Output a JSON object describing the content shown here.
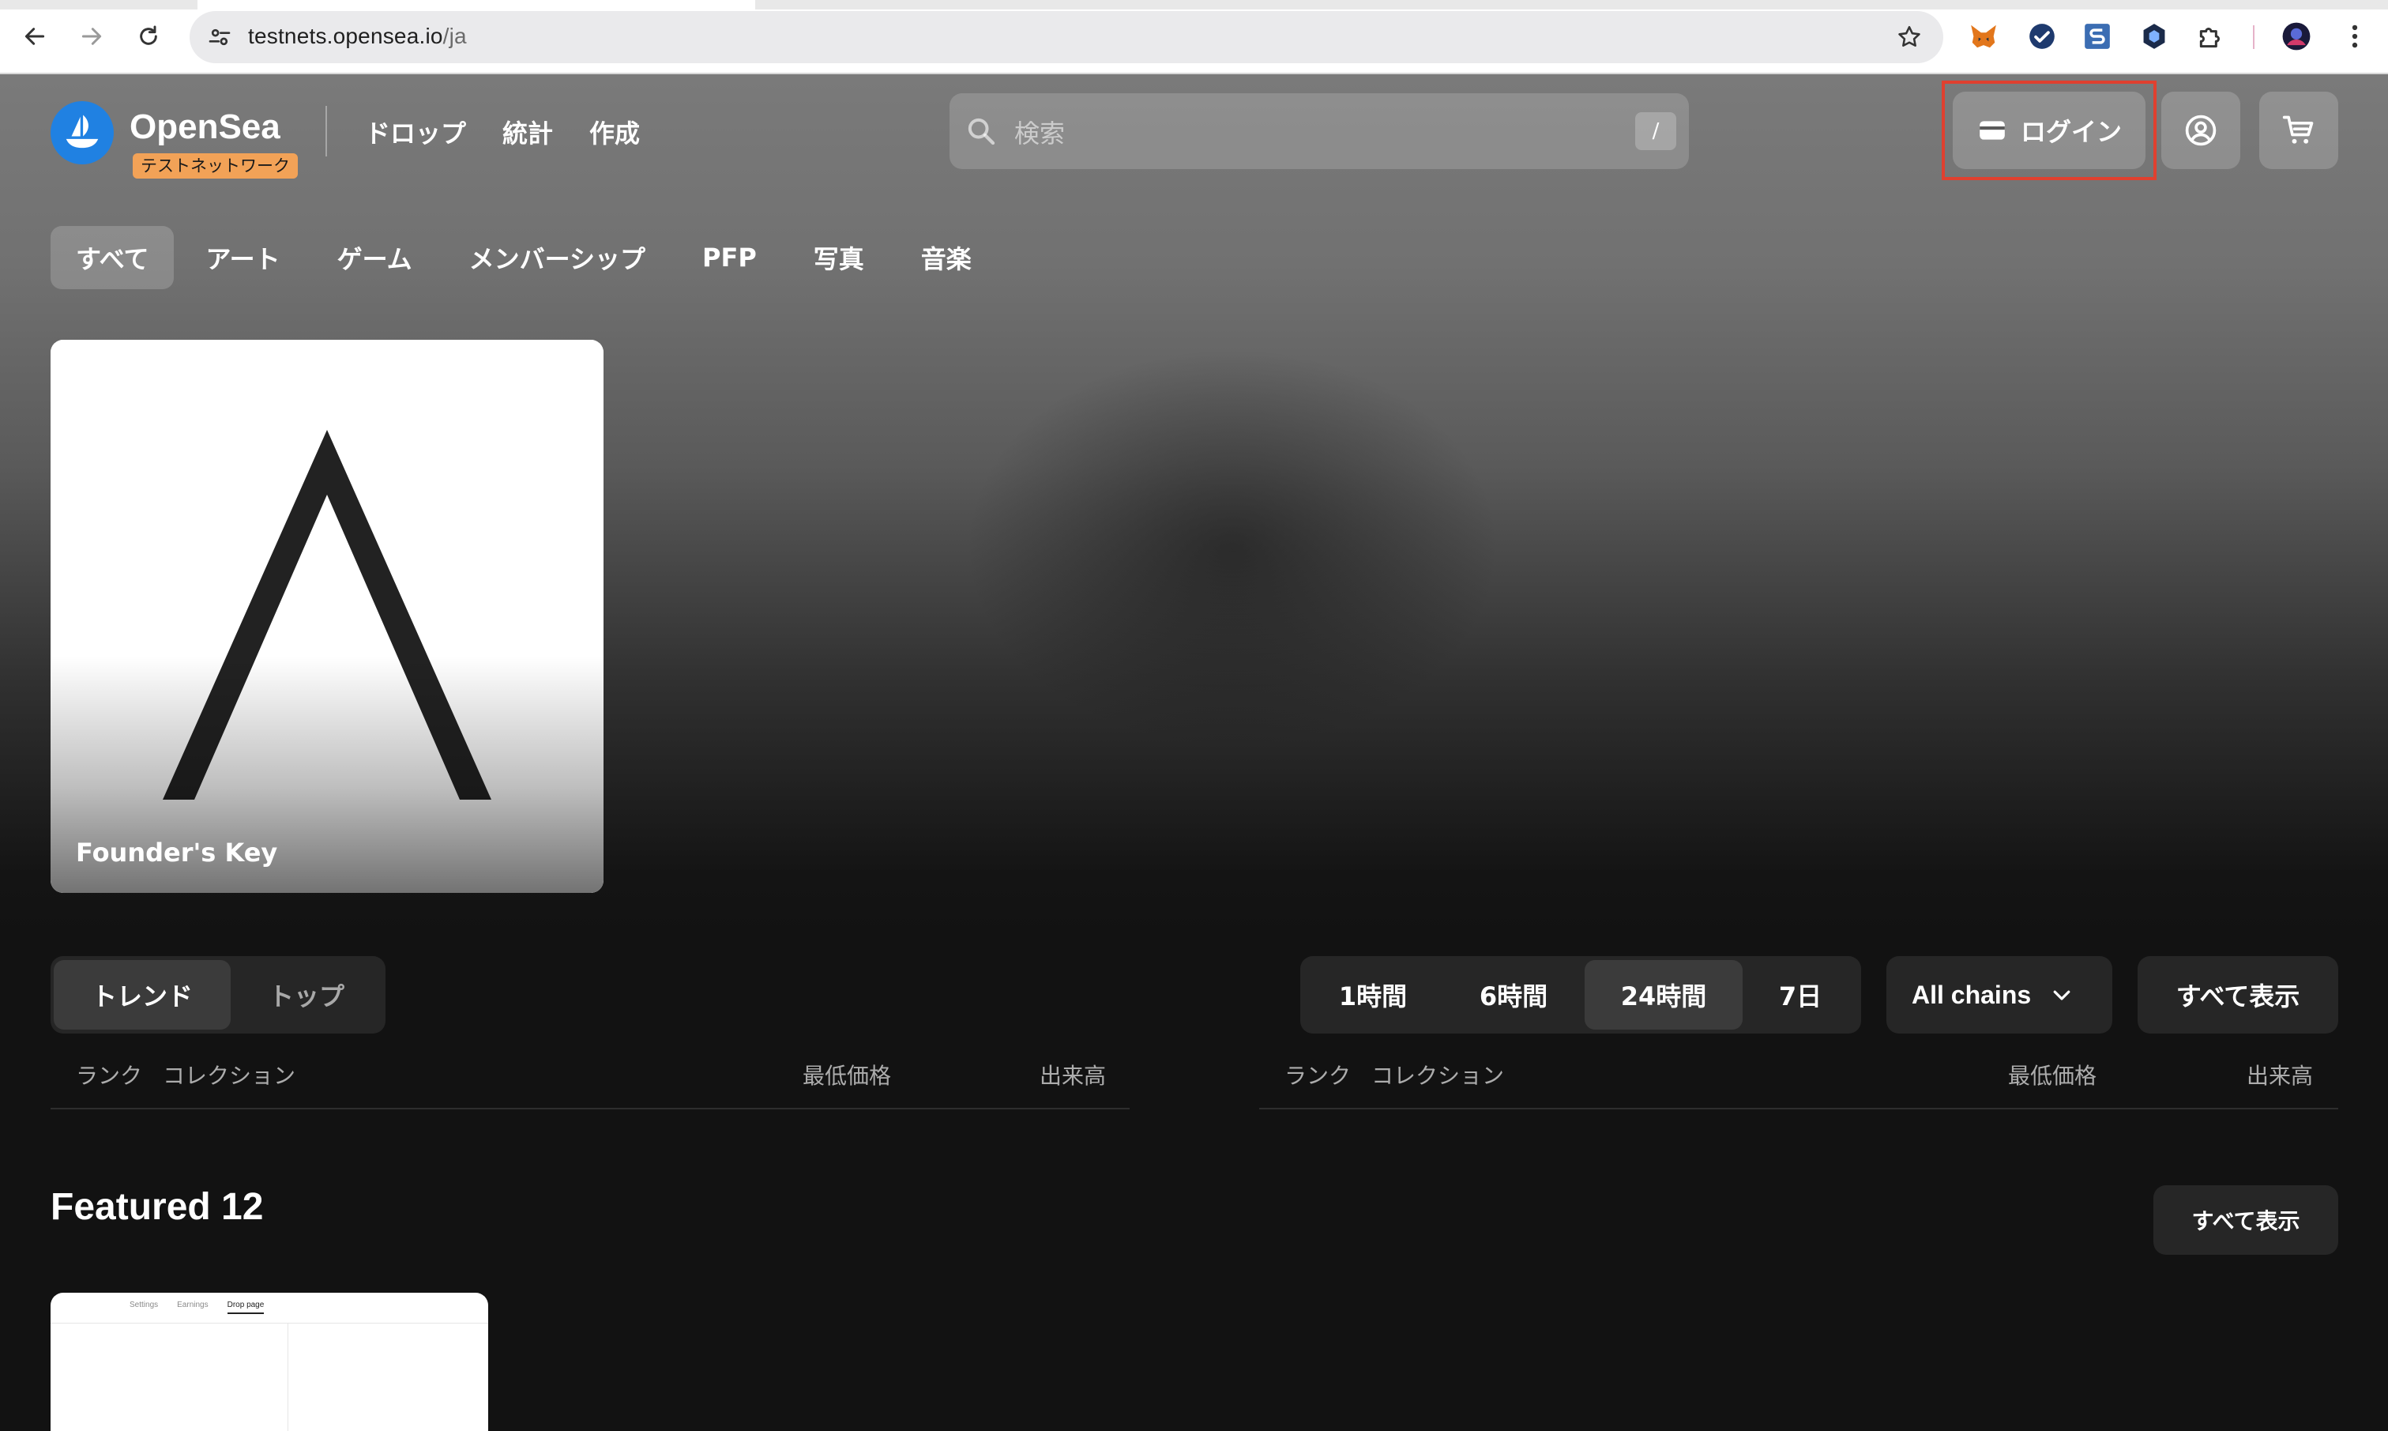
{
  "browser": {
    "url_host": "testnets.opensea.io",
    "url_path": "/ja",
    "extensions": [
      "fox-extension-icon",
      "check-badge-extension-icon",
      "s-extension-icon",
      "hex-shield-extension-icon",
      "puzzle-extensions-icon"
    ],
    "colors": {
      "chrome_bg": "#ffffff",
      "omnibox_bg": "#eaeaec"
    }
  },
  "header": {
    "brand": "OpenSea",
    "testnet_badge": "テストネットワーク",
    "nav": [
      "ドロップ",
      "統計",
      "作成"
    ],
    "search_placeholder": "検索",
    "search_shortcut": "/",
    "login_label": "ログイン"
  },
  "categories": {
    "active": "すべて",
    "items": [
      "すべて",
      "アート",
      "ゲーム",
      "メンバーシップ",
      "PFP",
      "写真",
      "音楽"
    ]
  },
  "hero": {
    "title": "Founder's Key"
  },
  "rank_toggle": {
    "items": [
      "トレンド",
      "トップ"
    ],
    "active": "トレンド"
  },
  "time_toggle": {
    "items": [
      "1時間",
      "6時間",
      "24時間",
      "7日"
    ],
    "active": "24時間"
  },
  "chains_label": "All chains",
  "view_all_label": "すべて表示",
  "table": {
    "headers": {
      "rank": "ランク",
      "collection": "コレクション",
      "floor": "最低価格",
      "volume": "出来高"
    }
  },
  "featured": {
    "title": "Featured 12",
    "view_all_label": "すべて表示",
    "card_tabs": [
      "Settings",
      "Earnings",
      "Drop page"
    ],
    "card_active_tab": "Drop page"
  },
  "colors": {
    "accent": "#2081e2",
    "badge": "#f2a257",
    "highlight_border": "#e0402f",
    "page_bg": "#121212"
  }
}
